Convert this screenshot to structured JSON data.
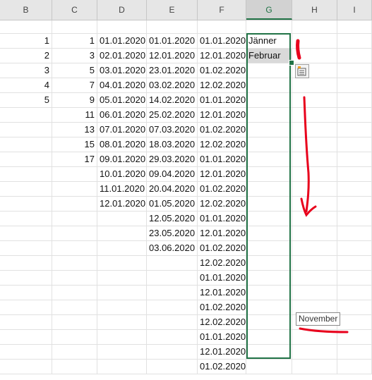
{
  "columns": [
    {
      "label": "B",
      "selected": false
    },
    {
      "label": "C",
      "selected": false
    },
    {
      "label": "D",
      "selected": false
    },
    {
      "label": "E",
      "selected": false
    },
    {
      "label": "F",
      "selected": false
    },
    {
      "label": "G",
      "selected": true
    },
    {
      "label": "H",
      "selected": false
    },
    {
      "label": "I",
      "selected": false
    }
  ],
  "column_b": [
    "1",
    "2",
    "3",
    "4",
    "5"
  ],
  "column_c": [
    "1",
    "3",
    "5",
    "7",
    "9",
    "11",
    "13",
    "15",
    "17"
  ],
  "column_d": [
    "01.01.2020",
    "02.01.2020",
    "03.01.2020",
    "04.01.2020",
    "05.01.2020",
    "06.01.2020",
    "07.01.2020",
    "08.01.2020",
    "09.01.2020",
    "10.01.2020",
    "11.01.2020",
    "12.01.2020"
  ],
  "column_e": [
    "01.01.2020",
    "12.01.2020",
    "23.01.2020",
    "03.02.2020",
    "14.02.2020",
    "25.02.2020",
    "07.03.2020",
    "18.03.2020",
    "29.03.2020",
    "09.04.2020",
    "20.04.2020",
    "01.05.2020",
    "12.05.2020",
    "23.05.2020",
    "03.06.2020"
  ],
  "column_f": [
    "01.01.2020",
    "12.01.2020",
    "01.02.2020",
    "12.02.2020",
    "01.01.2020",
    "12.01.2020",
    "01.02.2020",
    "12.02.2020",
    "01.01.2020",
    "12.01.2020",
    "01.02.2020",
    "12.02.2020",
    "01.01.2020",
    "12.01.2020",
    "01.02.2020",
    "12.02.2020",
    "01.01.2020",
    "12.01.2020",
    "01.02.2020",
    "12.02.2020",
    "01.01.2020",
    "12.01.2020",
    "01.02.2020"
  ],
  "column_g": [
    "Jänner",
    "Februar"
  ],
  "fill_tooltip": "November",
  "colors": {
    "accent": "#217346",
    "annotation": "#e8001c",
    "header_bg": "#e6e6e6",
    "selected_fill": "#d9d9d9"
  },
  "icons": {
    "autofill_options": "autofill-options-icon"
  }
}
